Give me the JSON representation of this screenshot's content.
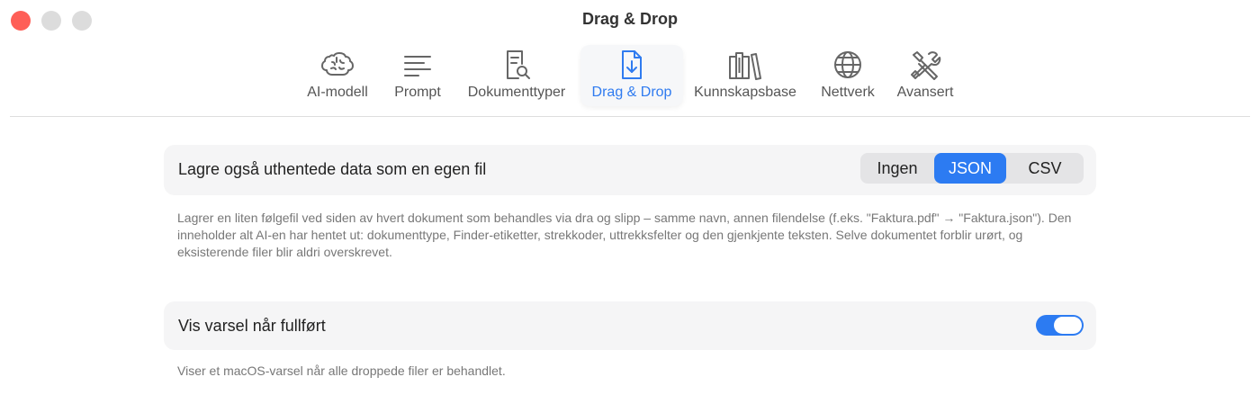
{
  "window": {
    "title": "Drag & Drop"
  },
  "tabs": [
    {
      "label": "AI-modell",
      "icon": "brain-icon"
    },
    {
      "label": "Prompt",
      "icon": "text-lines-icon"
    },
    {
      "label": "Dokumenttyper",
      "icon": "document-search-icon"
    },
    {
      "label": "Drag & Drop",
      "icon": "document-download-icon",
      "active": true
    },
    {
      "label": "Kunnskapsbase",
      "icon": "books-icon"
    },
    {
      "label": "Nettverk",
      "icon": "globe-icon"
    },
    {
      "label": "Avansert",
      "icon": "tools-icon"
    }
  ],
  "save_file": {
    "label": "Lagre også uthentede data som en egen fil",
    "options": [
      "Ingen",
      "JSON",
      "CSV"
    ],
    "selected": "JSON",
    "description": "Lagrer en liten følgefil ved siden av hvert dokument som behandles via dra og slipp – samme navn, annen filendelse (f.eks. \"Faktura.pdf\" → \"Faktura.json\"). Den inneholder alt AI-en har hentet ut: dokumenttype, Finder-etiketter, strekkoder, uttrekksfelter og den gjenkjente teksten. Selve dokumentet forblir urørt, og eksisterende filer blir aldri overskrevet."
  },
  "notify": {
    "label": "Vis varsel når fullført",
    "enabled": true,
    "description": "Viser et macOS-varsel når alle droppede filer er behandlet."
  },
  "colors": {
    "accent": "#2c7bf2",
    "close": "#fe5f57"
  }
}
